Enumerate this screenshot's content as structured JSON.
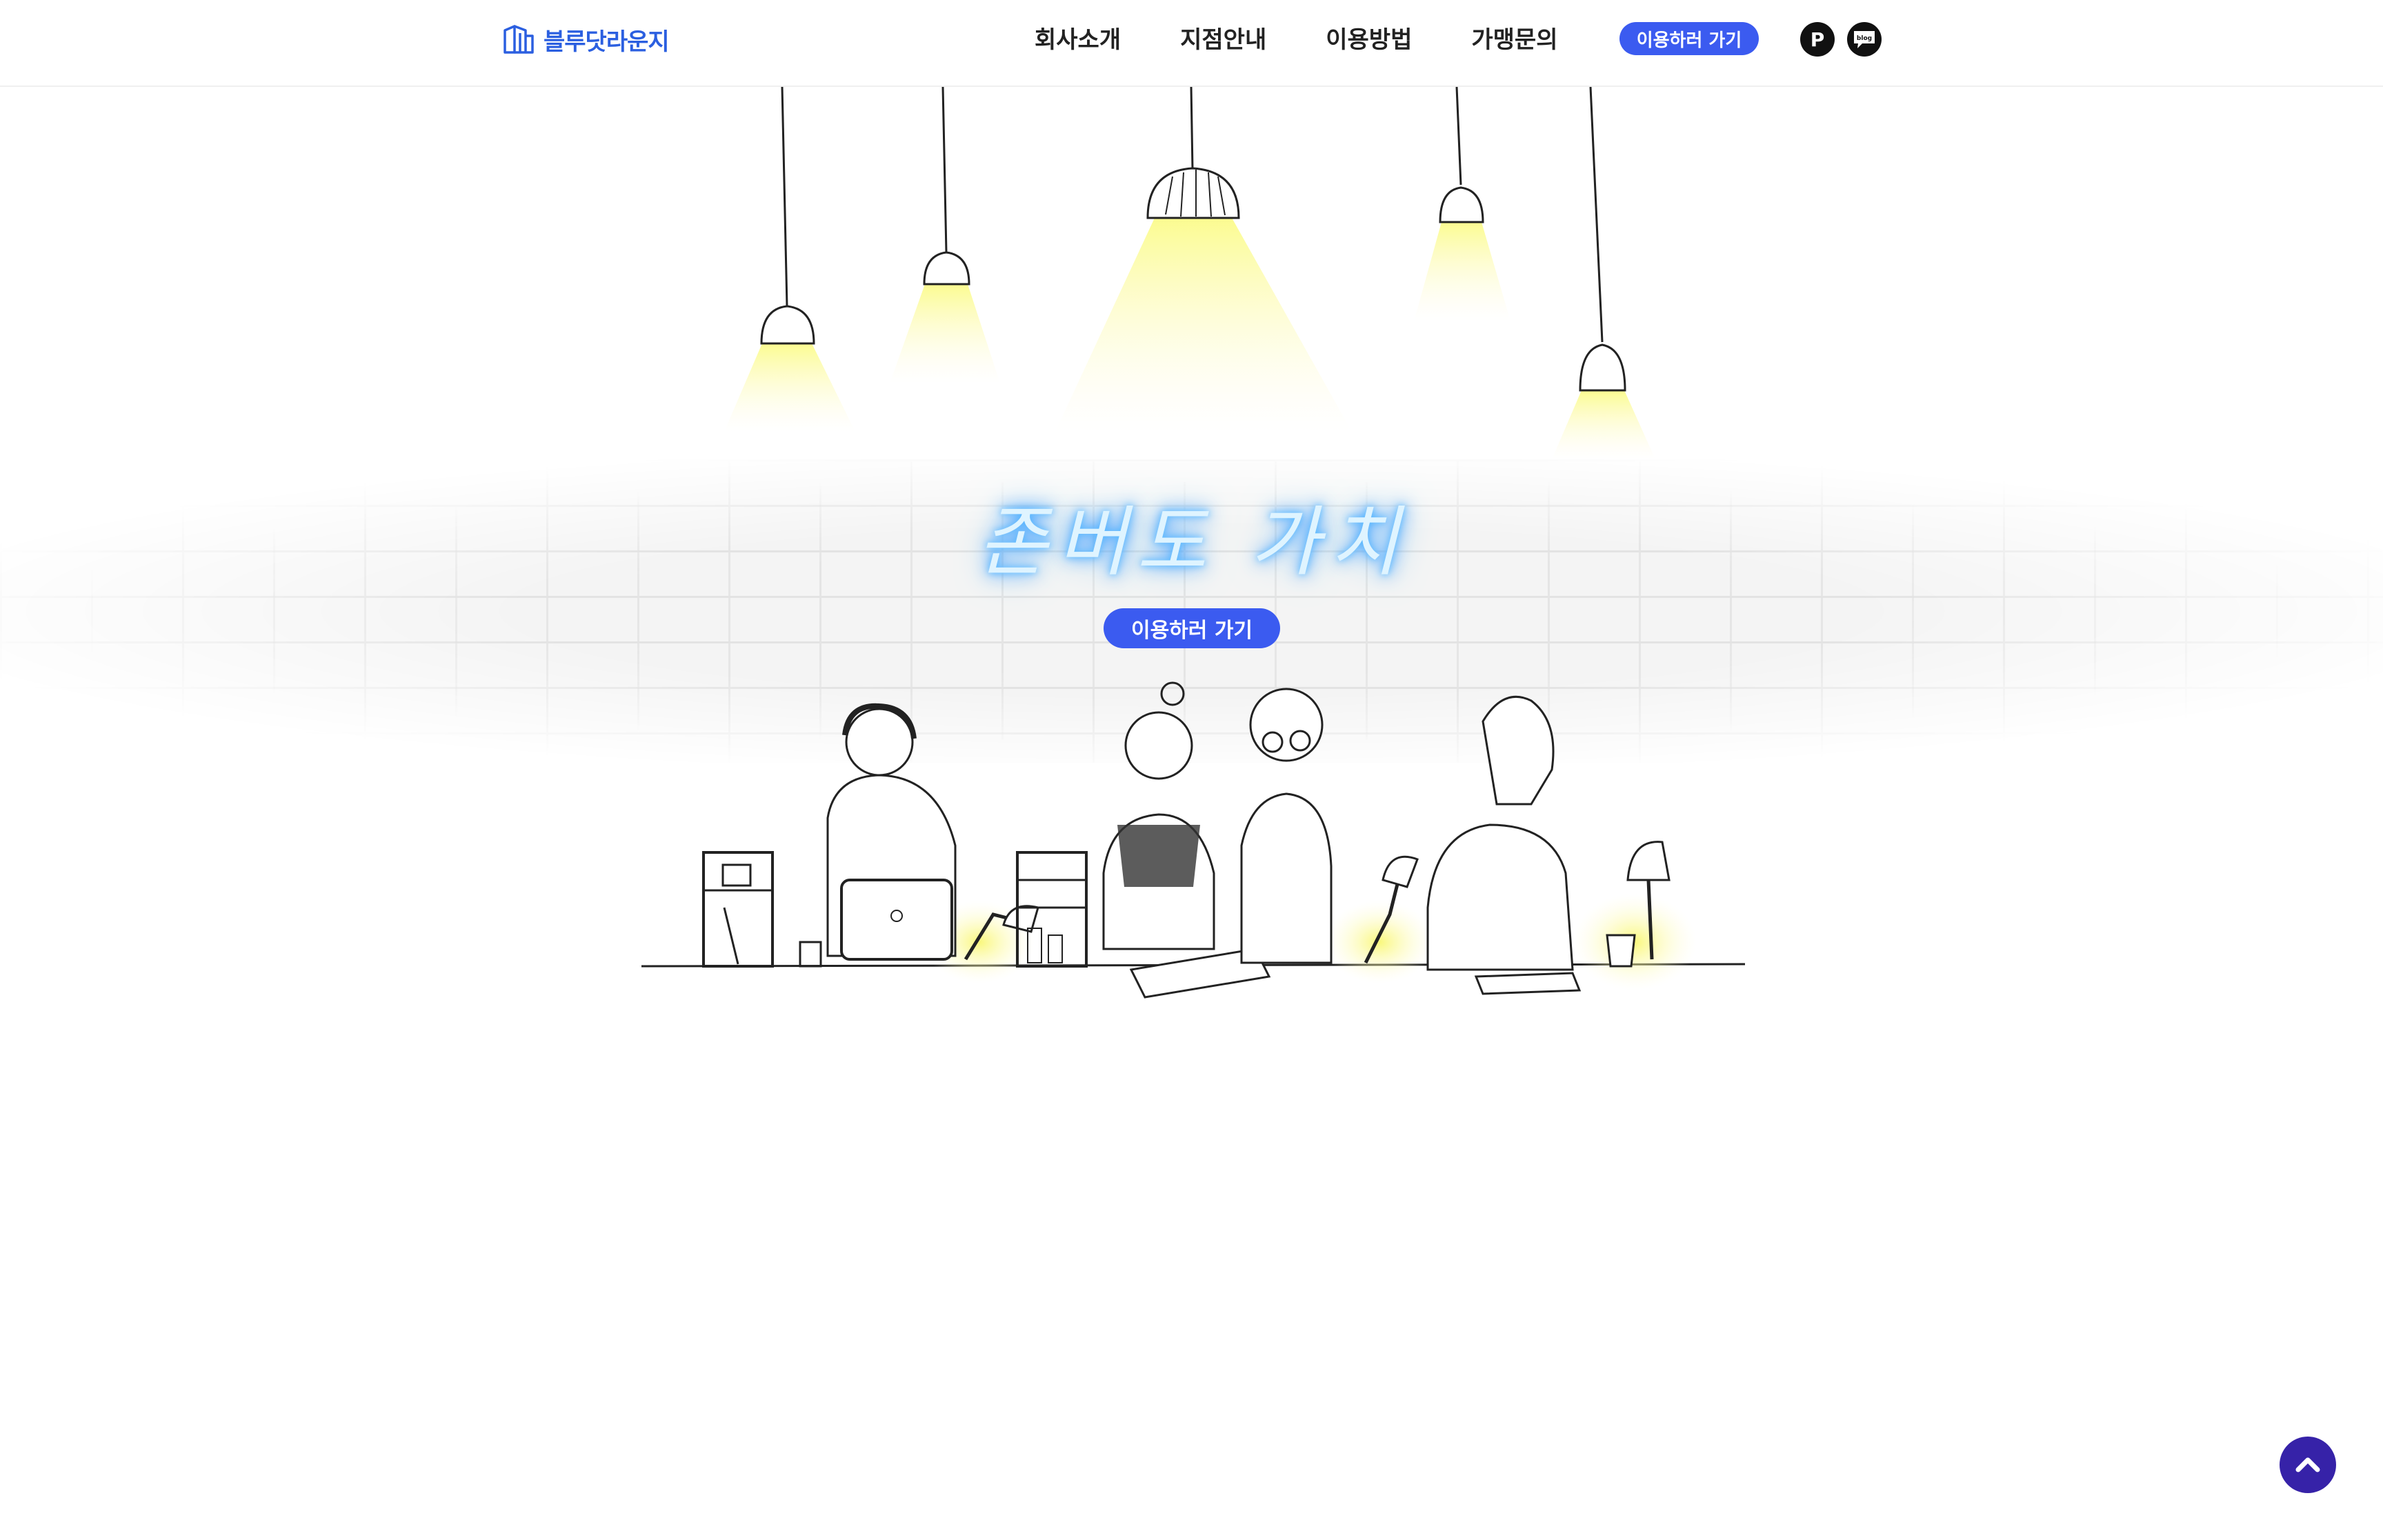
{
  "brand": {
    "name": "블루닷라운지",
    "color": "#2b5fe0"
  },
  "nav": {
    "items": [
      {
        "label": "회사소개"
      },
      {
        "label": "지점안내"
      },
      {
        "label": "이용방법"
      },
      {
        "label": "가맹문의"
      }
    ],
    "cta_label": "이용하러 가기",
    "social": [
      {
        "icon": "naver-place-icon",
        "label": "P"
      },
      {
        "icon": "blog-icon",
        "label": "blog"
      }
    ]
  },
  "hero": {
    "headline": "존버도 가치",
    "cta_label": "이용하러 가기",
    "accent_color": "#3b5bf0",
    "glow_color": "#4fb7ff"
  },
  "scroll_top": {
    "icon": "chevron-up-icon",
    "color": "#3622a8"
  }
}
